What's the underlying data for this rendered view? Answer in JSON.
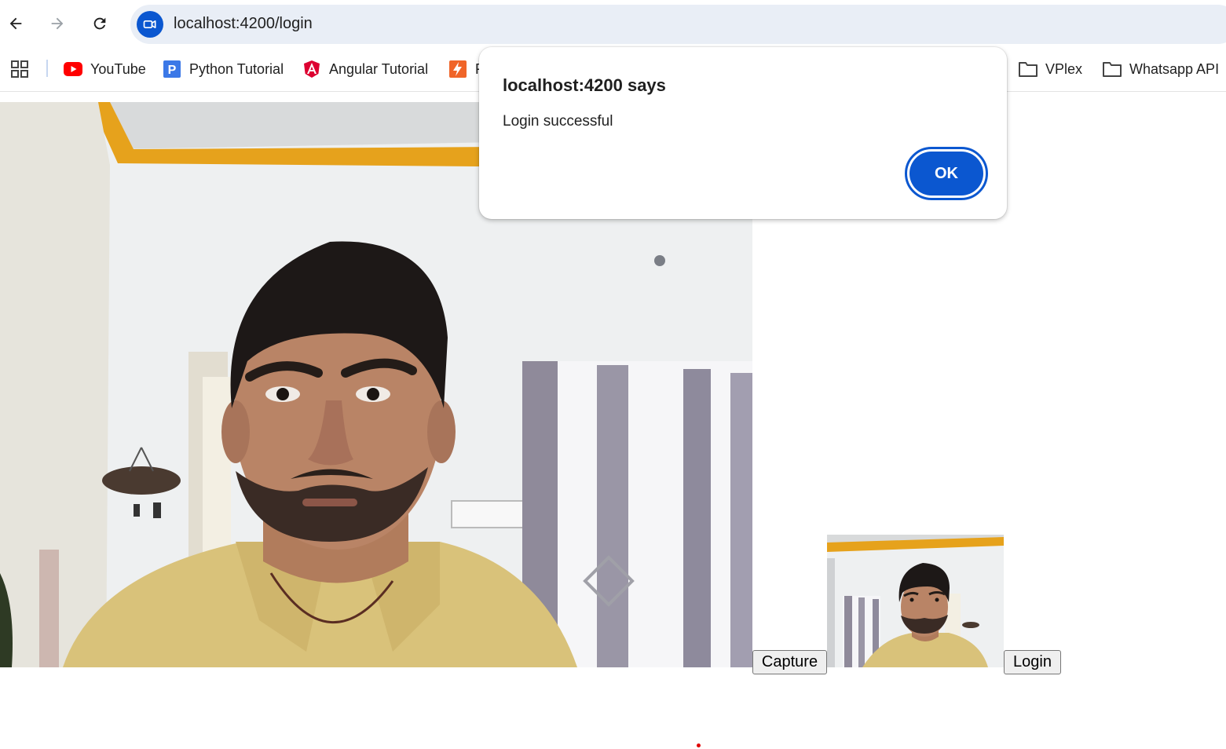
{
  "browser": {
    "url": "localhost:4200/login",
    "bookmarks": [
      {
        "label": "YouTube",
        "icon": "youtube-icon"
      },
      {
        "label": "Python Tutorial",
        "icon": "python-tutorial-icon"
      },
      {
        "label": "Angular Tutorial",
        "icon": "angular-icon"
      },
      {
        "label": "F",
        "icon": "bolt-icon"
      },
      {
        "label": "VPlex",
        "icon": "folder-icon"
      },
      {
        "label": "Whatsapp API",
        "icon": "folder-icon"
      }
    ]
  },
  "page": {
    "capture_label": "Capture",
    "login_label": "Login"
  },
  "dialog": {
    "title": "localhost:4200 says",
    "message": "Login successful",
    "ok_label": "OK"
  },
  "colors": {
    "accent": "#0b57d0",
    "omnibox": "#e9eef6",
    "youtube": "#ff0000",
    "python_tutorial": "#3b78e7",
    "angular": "#dd0031",
    "bolt": "#f06529",
    "wall": "#f2f3f3",
    "shirt": "#d9c27a",
    "ceiling_trim": "#e6a21c"
  }
}
